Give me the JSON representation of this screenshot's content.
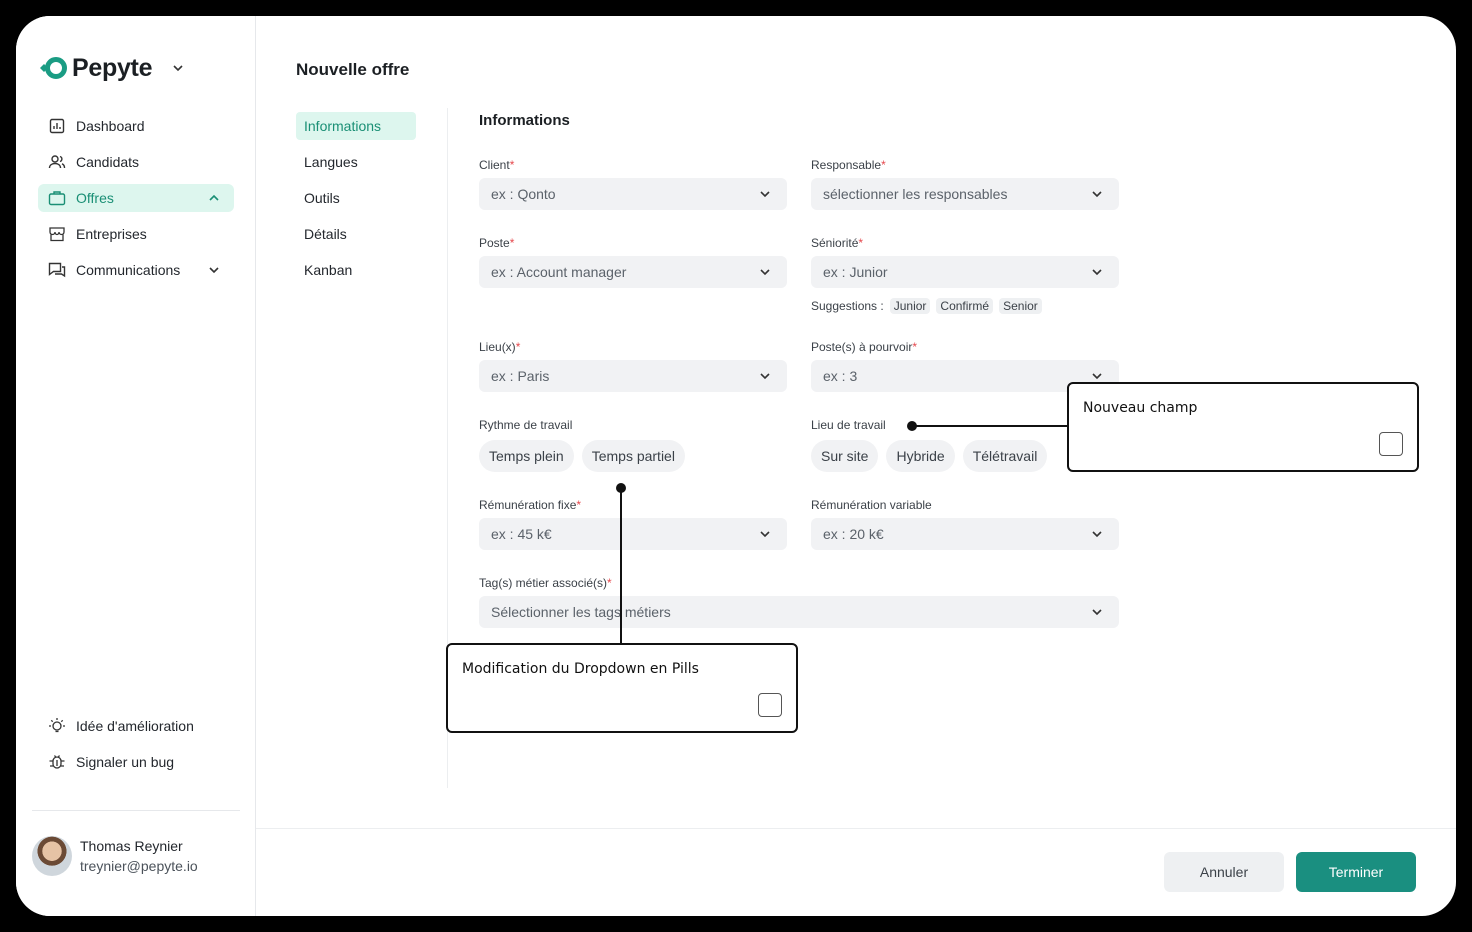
{
  "brand": {
    "name": "Pepyte",
    "accent": "#1a8f75"
  },
  "sidebar": {
    "items": [
      {
        "label": "Dashboard",
        "icon": "chart-icon"
      },
      {
        "label": "Candidats",
        "icon": "users-icon"
      },
      {
        "label": "Offres",
        "icon": "briefcase-icon",
        "active": true
      },
      {
        "label": "Entreprises",
        "icon": "store-icon"
      },
      {
        "label": "Communications",
        "icon": "chat-icon"
      }
    ],
    "bottom": [
      {
        "label": "Idée d'amélioration",
        "icon": "lightbulb-icon"
      },
      {
        "label": "Signaler un bug",
        "icon": "bug-icon"
      }
    ],
    "profile": {
      "name": "Thomas Reynier",
      "email": "treynier@pepyte.io"
    }
  },
  "page": {
    "title": "Nouvelle offre"
  },
  "subnav": [
    "Informations",
    "Langues",
    "Outils",
    "Détails",
    "Kanban"
  ],
  "form": {
    "section_title": "Informations",
    "client": {
      "label": "Client",
      "placeholder": "ex : Qonto"
    },
    "responsable": {
      "label": "Responsable",
      "placeholder": "sélectionner les responsables"
    },
    "poste": {
      "label": "Poste",
      "placeholder": "ex : Account manager"
    },
    "seniorite": {
      "label": "Séniorité",
      "placeholder": "ex : Junior"
    },
    "suggestions": {
      "label": "Suggestions :",
      "chips": [
        "Junior",
        "Confirmé",
        "Senior"
      ]
    },
    "lieux": {
      "label": "Lieu(x)",
      "placeholder": "ex : Paris"
    },
    "postes_pourvoir": {
      "label": "Poste(s) à pourvoir",
      "placeholder": "ex : 3"
    },
    "rythme": {
      "label": "Rythme de travail",
      "pills": [
        "Temps plein",
        "Temps partiel"
      ]
    },
    "lieu_travail": {
      "label": "Lieu de travail",
      "pills": [
        "Sur site",
        "Hybride",
        "Télétravail"
      ]
    },
    "remu_fixe": {
      "label": "Rémunération fixe",
      "placeholder": "ex : 45 k€"
    },
    "remu_variable": {
      "label": "Rémunération variable",
      "placeholder": "ex : 20 k€"
    },
    "tags": {
      "label": "Tag(s) métier associé(s)",
      "placeholder": "Sélectionner les tags métiers"
    },
    "required_mark": "*"
  },
  "annotations": {
    "new_field": "Nouveau champ",
    "dropdown_pills": "Modification du Dropdown en Pills"
  },
  "footer": {
    "cancel": "Annuler",
    "submit": "Terminer"
  }
}
